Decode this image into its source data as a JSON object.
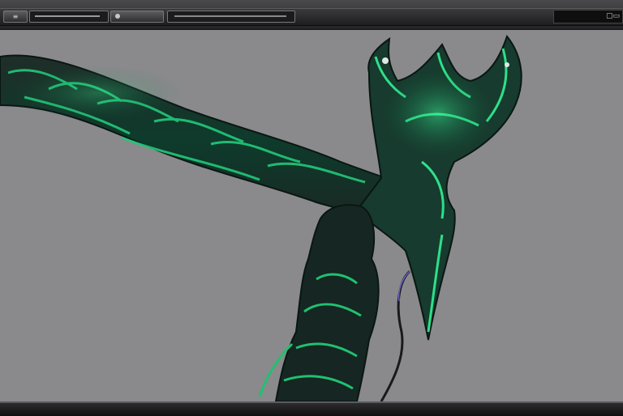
{
  "toolbar": {
    "menu_icon": "menu-icon",
    "dropdown_icon": "dot-icon",
    "right_icon": "window-icon"
  },
  "viewport": {
    "background_color": "#8a8a8c",
    "model_colors": {
      "dark": "#1d2b25",
      "mid": "#14553f",
      "glow": "#23d17c"
    }
  }
}
